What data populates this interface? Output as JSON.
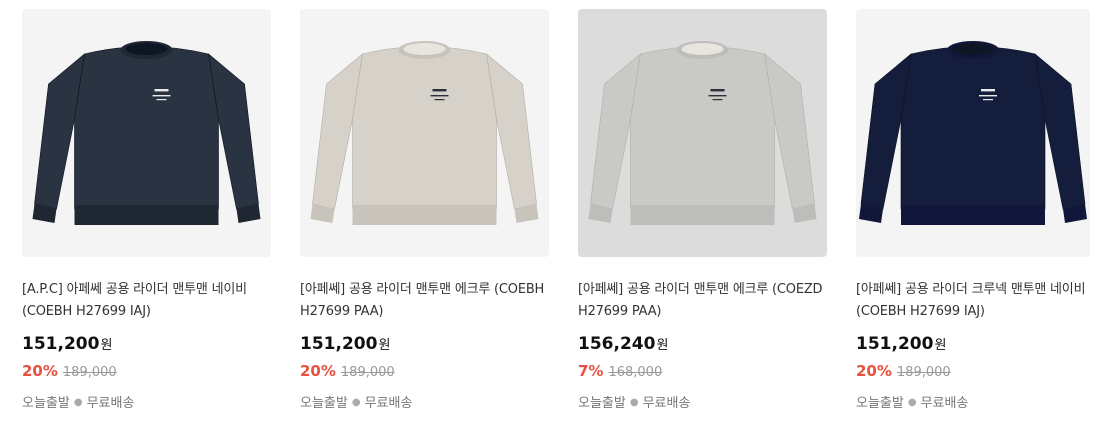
{
  "products": [
    {
      "title": "[A.P.C] 아페쎄 공용 라이더 맨투맨 네이비 (COEBH H27699 IAJ)",
      "price": "151,200",
      "currency": "원",
      "discount": "20%",
      "original_price": "189,000",
      "shipping_today": "오늘출발",
      "shipping_free": "무료배송",
      "image_label": "A.P.C.",
      "sweater_color": "#2a3342",
      "rib_color": "#1f2733"
    },
    {
      "title": "[아페쎄] 공용 라이더 맨투맨 에크루 (COEBH H27699 PAA)",
      "price": "151,200",
      "currency": "원",
      "discount": "20%",
      "original_price": "189,000",
      "shipping_today": "오늘출발",
      "shipping_free": "무료배송",
      "image_label": "A.P.C.",
      "sweater_color": "#d6d1c9",
      "rib_color": "#c9c4bb"
    },
    {
      "title": "[아페쎄] 공용 라이더 맨투맨 에크루 (COEZD H27699 PAA)",
      "price": "156,240",
      "currency": "원",
      "discount": "7%",
      "original_price": "168,000",
      "shipping_today": "오늘출발",
      "shipping_free": "무료배송",
      "image_label": "A.P.C.",
      "sweater_color": "#c9c9c6",
      "rib_color": "#bdbdb9"
    },
    {
      "title": "[아페쎄] 공용 라이더 크루넥 맨투맨 네이비 (COEBH H27699 IAJ)",
      "price": "151,200",
      "currency": "원",
      "discount": "20%",
      "original_price": "189,000",
      "shipping_today": "오늘출발",
      "shipping_free": "무료배송",
      "image_label": "A.P.C.",
      "sweater_color": "#151d3d",
      "rib_color": "#10173a"
    }
  ],
  "colors": {
    "discount": "#e8523f",
    "card_bg": "#f4f4f4"
  }
}
